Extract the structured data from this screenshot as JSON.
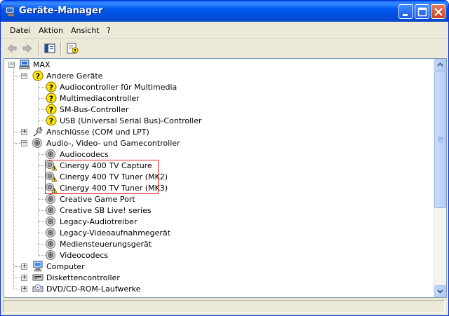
{
  "window": {
    "title": "Geräte-Manager"
  },
  "menu": {
    "items": [
      "Datei",
      "Aktion",
      "Ansicht",
      "?"
    ]
  },
  "tree": {
    "root": "MAX",
    "andere_geraete": {
      "label": "Andere Geräte",
      "children": [
        "Audiocontroller für Multimedia",
        "Multimediacontroller",
        "SM-Bus-Controller",
        "USB (Universal Serial Bus)-Controller"
      ]
    },
    "anschluesse": "Anschlüsse (COM und LPT)",
    "audio": {
      "label": "Audio-, Video- und Gamecontroller",
      "children": [
        "Audiocodecs",
        "Cinergy 400 TV Capture",
        "Cinergy 400 TV Tuner (MK2)",
        "Cinergy 400 TV Tuner (MK3)",
        "Creative Game Port",
        "Creative SB Live! series",
        "Legacy-Audiotreiber",
        "Legacy-Videoaufnahmegerät",
        "Mediensteuerungsgerät",
        "Videocodecs"
      ]
    },
    "computer": "Computer",
    "diskettencontroller": "Diskettencontroller",
    "dvd": "DVD/CD-ROM-Laufwerke"
  },
  "colors": {
    "titlebar": "#0058ee",
    "highlight": "#dd2222",
    "warning": "#ffd800"
  }
}
